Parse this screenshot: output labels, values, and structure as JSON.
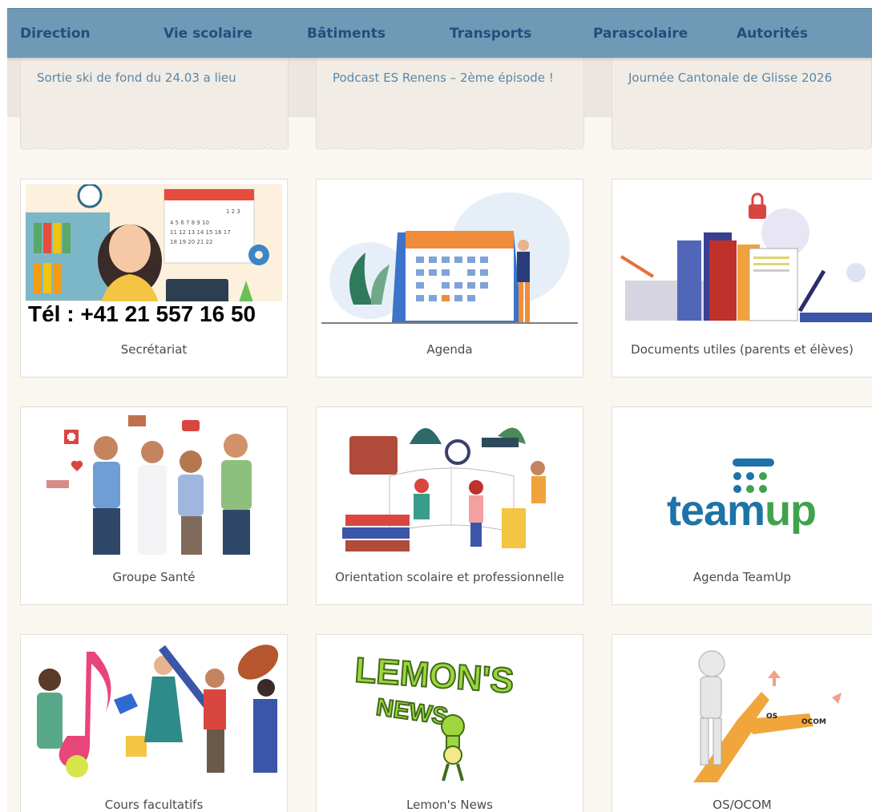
{
  "nav": {
    "items": [
      {
        "label": "Direction"
      },
      {
        "label": "Vie scolaire"
      },
      {
        "label": "Bâtiments"
      },
      {
        "label": "Transports"
      },
      {
        "label": "Parascolaire"
      },
      {
        "label": "Autorités"
      }
    ]
  },
  "news": [
    {
      "title": "Sortie ski de fond du 24.03 a lieu"
    },
    {
      "title": "Podcast ES Renens – 2ème épisode !"
    },
    {
      "title": "Journée Cantonale de Glisse 2026"
    }
  ],
  "tiles": [
    {
      "label": "Secrétariat",
      "image_text": "Tél : +41 21 557 16 50",
      "icon": "secretary-illustration"
    },
    {
      "label": "Agenda",
      "icon": "calendar-illustration"
    },
    {
      "label": "Documents utiles (parents et élèves)",
      "icon": "documents-illustration"
    },
    {
      "label": "Groupe Santé",
      "icon": "health-team-illustration"
    },
    {
      "label": "Orientation scolaire et professionnelle",
      "icon": "orientation-illustration"
    },
    {
      "label": "Agenda TeamUp",
      "image_text": "teamup",
      "icon": "teamup-logo"
    },
    {
      "label": "Cours facultatifs",
      "icon": "optional-courses-illustration"
    },
    {
      "label": "Lemon's News",
      "image_text": "LEMON'S NEWS",
      "icon": "lemons-news-logo"
    },
    {
      "label": "OS/OCOM",
      "image_text_a": "OS",
      "image_text_b": "OCOM",
      "icon": "crossroads-illustration"
    }
  ],
  "colors": {
    "nav_bg": "#6f9ab5",
    "nav_text": "#1f4f80",
    "link": "#5b87a8",
    "page_bg": "#faf7f1"
  }
}
